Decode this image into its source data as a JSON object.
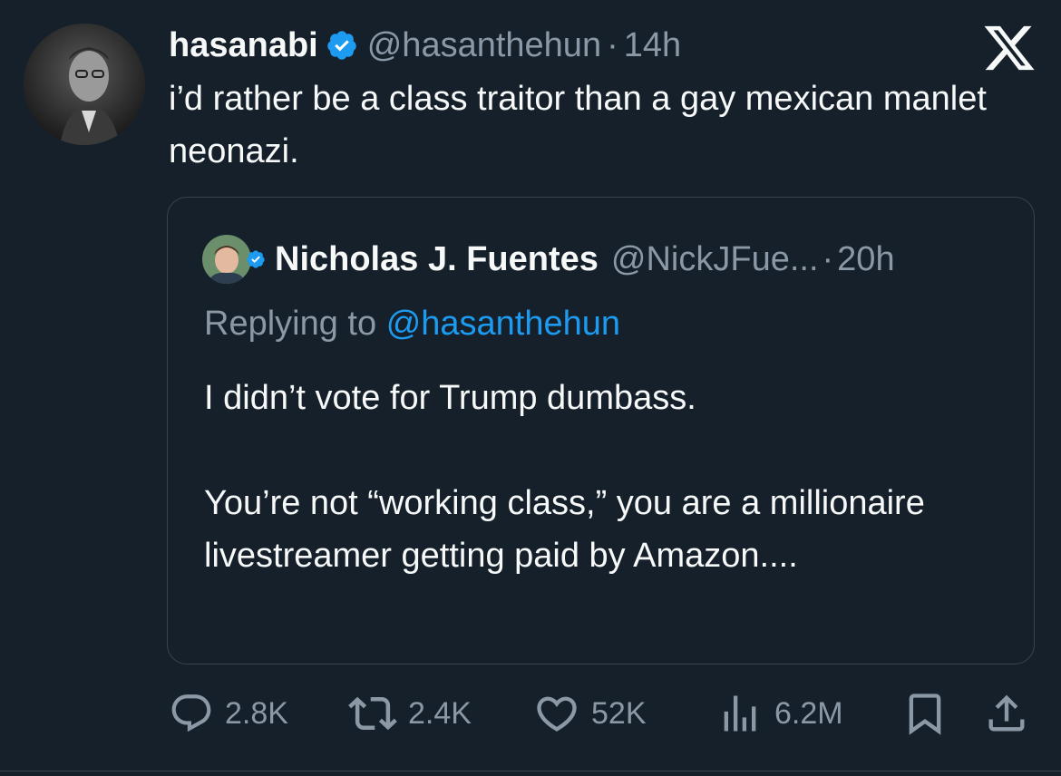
{
  "tweet": {
    "display_name": "hasanabi",
    "handle": "@hasanthehun",
    "separator": "·",
    "time": "14h",
    "text": "i’d rather be a class traitor than a gay mexican manlet neonazi."
  },
  "quoted": {
    "display_name": "Nicholas J. Fuentes",
    "handle": "@NickJFue...",
    "separator": "·",
    "time": "20h",
    "replying_prefix": "Replying to",
    "replying_handle": "@hasanthehun",
    "text_lines": [
      "I didn’t vote for Trump dumbass.",
      "You’re not “working class,” you are a millionaire livestreamer getting paid by Amazon...."
    ]
  },
  "actions": {
    "replies": "2.8K",
    "reposts": "2.4K",
    "likes": "52K",
    "views": "6.2M"
  },
  "icons": {
    "verified": "verified-badge-icon",
    "x_logo": "x-logo-icon",
    "reply": "reply-icon",
    "repost": "repost-icon",
    "like": "heart-icon",
    "views": "views-icon",
    "bookmark": "bookmark-icon",
    "share": "share-icon"
  },
  "colors": {
    "background": "#15202b",
    "text": "#f7f9f9",
    "secondary": "#8b98a5",
    "accent": "#1d9bf0",
    "border": "#38444d"
  }
}
